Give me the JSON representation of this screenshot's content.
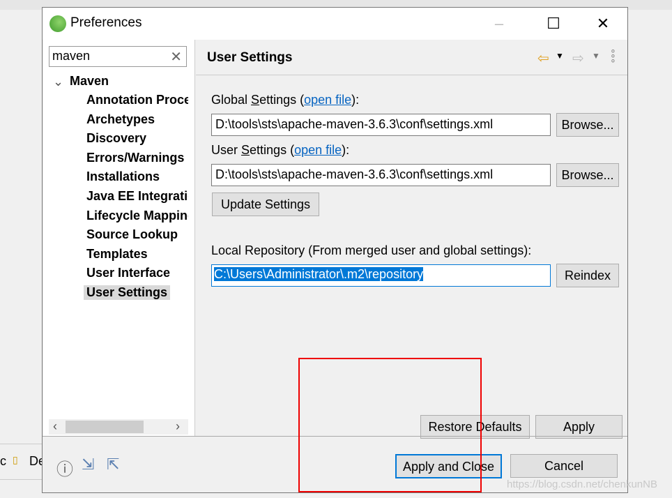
{
  "window": {
    "title": "Preferences",
    "maximize_icon": "square",
    "close_icon": "x"
  },
  "tree": {
    "search_value": "maven",
    "root": "Maven",
    "items": [
      "Annotation Processing",
      "Archetypes",
      "Discovery",
      "Errors/Warnings",
      "Installations",
      "Java EE Integration",
      "Lifecycle Mappings",
      "Source Lookup",
      "Templates",
      "User Interface",
      "User Settings"
    ],
    "selected": "User Settings"
  },
  "page": {
    "title": "User Settings",
    "global_label_pre": "Global ",
    "global_label_u": "S",
    "global_label_post": "ettings (",
    "open_file": "open file",
    "label_close": "):",
    "global_value": "D:\\tools\\sts\\apache-maven-3.6.3\\conf\\settings.xml",
    "user_label_pre": "User ",
    "user_label_u": "S",
    "user_label_post": "ettings (",
    "user_value": "D:\\tools\\sts\\apache-maven-3.6.3\\conf\\settings.xml",
    "browse": "Browse...",
    "update": "Update Settings",
    "local_label": "Local Repository (From merged user and global settings):",
    "local_value": "C:\\Users\\Administrator\\.m2\\repository",
    "reindex": "Reindex",
    "restore": "Restore Defaults",
    "apply": "Apply"
  },
  "footer": {
    "apply_close": "Apply and Close",
    "cancel": "Cancel"
  },
  "background": {
    "left_text_1": "c",
    "left_text_2": "De",
    "watermark": "https://blog.csdn.net/chenkunNB"
  },
  "colors": {
    "accent": "#0078d7",
    "link": "#0563c1",
    "highlight_box": "#e00000"
  }
}
